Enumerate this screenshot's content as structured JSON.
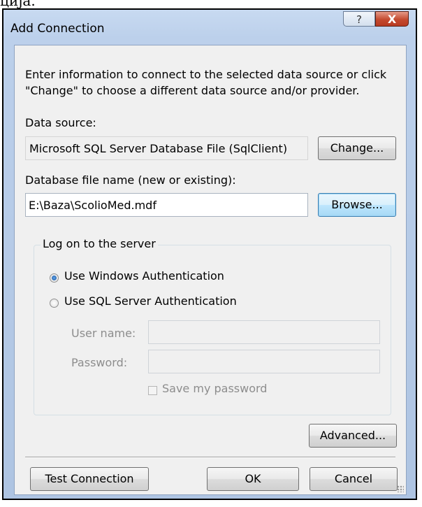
{
  "caption": "ција.",
  "window": {
    "title": "Add Connection",
    "help_glyph": "?",
    "close_glyph": "X"
  },
  "intro": {
    "line1": "Enter information to connect to the selected data source or click",
    "line2": "\"Change\" to choose a different data source and/or provider."
  },
  "data_source": {
    "label": "Data source:",
    "value": "Microsoft SQL Server Database File (SqlClient)",
    "change_button": "Change..."
  },
  "database_file": {
    "label": "Database file name (new or existing):",
    "value": "E:\\Baza\\ScolioMed.mdf",
    "browse_button": "Browse..."
  },
  "logon": {
    "legend": "Log on to the server",
    "windows_auth": "Use Windows Authentication",
    "sql_auth": "Use SQL Server Authentication",
    "windows_auth_selected": true,
    "user_name_label": "User name:",
    "user_name_value": "",
    "password_label": "Password:",
    "password_value": "",
    "save_password_label": "Save my password"
  },
  "buttons": {
    "advanced": "Advanced...",
    "test_connection": "Test Connection",
    "ok": "OK",
    "cancel": "Cancel"
  },
  "colors": {
    "title_bar": "#bcd0eb",
    "close_button": "#c44a2f",
    "dialog_background": "#f0f0f0"
  }
}
